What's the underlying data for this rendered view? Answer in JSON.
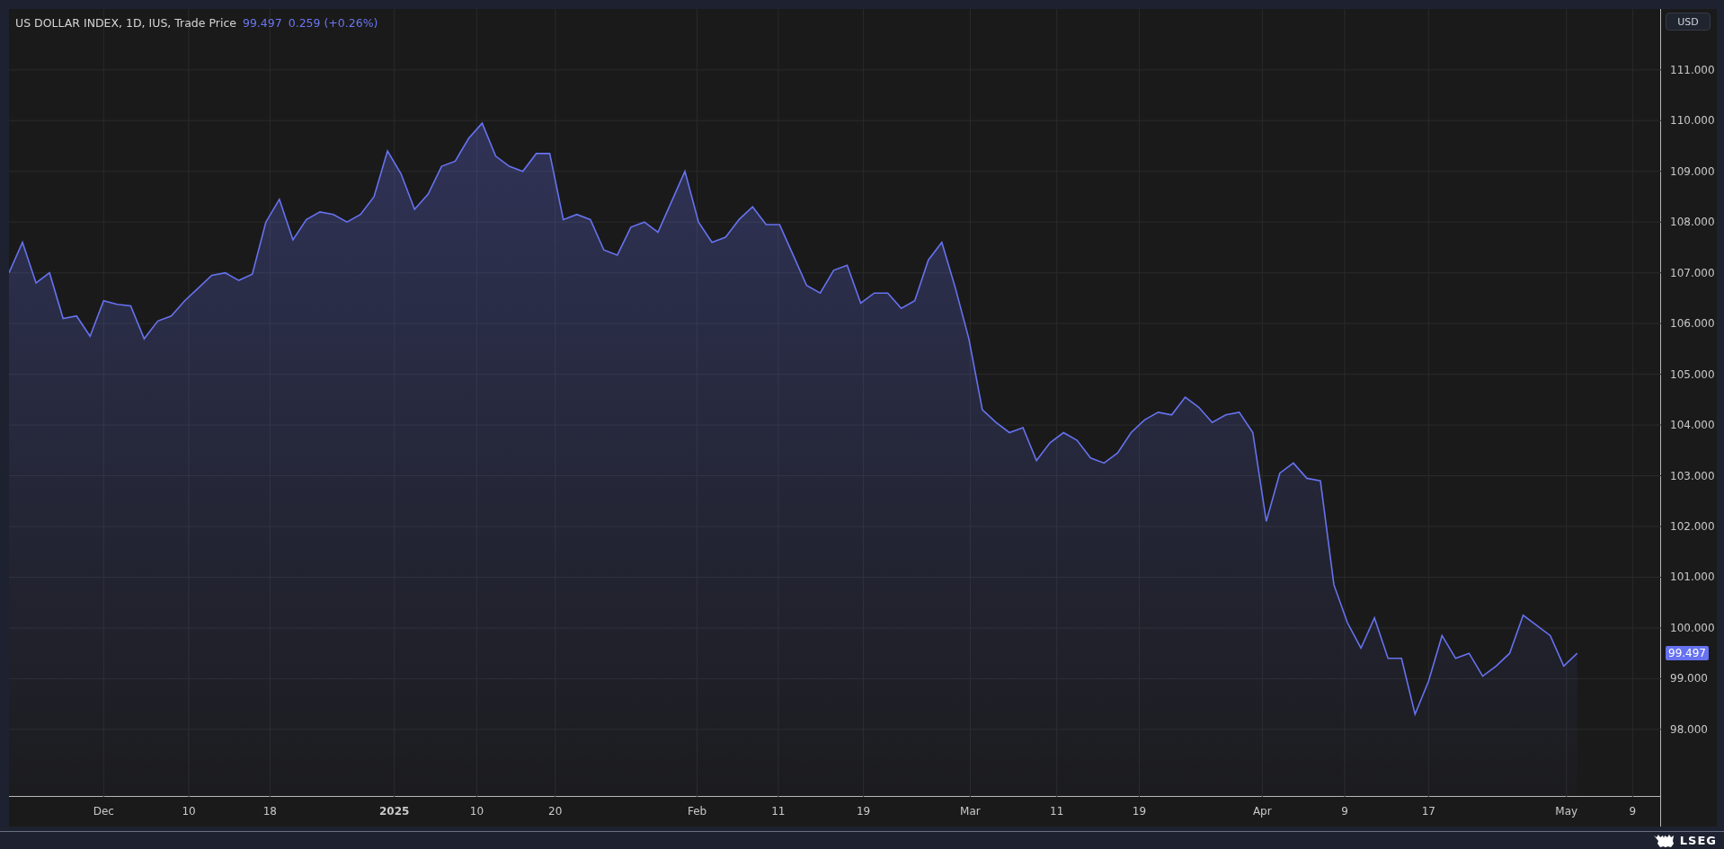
{
  "legend": {
    "title": "US DOLLAR INDEX, 1D, IUS, Trade Price",
    "last": "99.497",
    "change": "0.259 (+0.26%)"
  },
  "currency_button": "USD",
  "price_tag": "99.497",
  "logo": "LSEG",
  "x_axis_labels": [
    "Dec",
    "10",
    "18",
    "2025",
    "10",
    "20",
    "Feb",
    "11",
    "19",
    "Mar",
    "11",
    "19",
    "Apr",
    "9",
    "17",
    "May",
    "9"
  ],
  "chart_data": {
    "type": "area",
    "grid": true,
    "ylim": [
      96.67,
      112.2
    ],
    "series": [
      {
        "color": "#6672f0",
        "values": [
          107.0,
          107.6,
          106.8,
          107.0,
          106.1,
          106.15,
          105.75,
          106.45,
          106.38,
          106.35,
          105.7,
          106.05,
          106.15,
          106.45,
          106.7,
          106.95,
          107.0,
          106.85,
          106.97,
          108.0,
          108.45,
          107.65,
          108.05,
          108.2,
          108.15,
          108.0,
          108.15,
          108.5,
          109.4,
          108.95,
          108.25,
          108.55,
          109.1,
          109.2,
          109.65,
          109.95,
          109.3,
          109.1,
          109.0,
          109.35,
          109.35,
          108.05,
          108.15,
          108.05,
          107.45,
          107.35,
          107.9,
          108.0,
          107.8,
          108.4,
          109.0,
          108.0,
          107.6,
          107.7,
          108.05,
          108.3,
          107.95,
          107.95,
          107.35,
          106.75,
          106.6,
          107.05,
          107.15,
          106.4,
          106.6,
          106.6,
          106.3,
          106.45,
          107.25,
          107.6,
          106.7,
          105.7,
          104.3,
          104.05,
          103.85,
          103.95,
          103.3,
          103.65,
          103.85,
          103.7,
          103.35,
          103.25,
          103.45,
          103.85,
          104.1,
          104.25,
          104.2,
          104.55,
          104.35,
          104.05,
          104.2,
          104.25,
          103.85,
          102.1,
          103.05,
          103.25,
          102.95,
          102.9,
          100.85,
          100.1,
          99.6,
          100.2,
          99.4,
          99.4,
          98.3,
          98.95,
          99.85,
          99.4,
          99.5,
          99.05,
          99.25,
          99.5,
          100.25,
          100.05,
          99.85,
          99.25,
          99.5
        ]
      }
    ],
    "yticks": [
      {
        "value": 111,
        "label": "111.000"
      },
      {
        "value": 110,
        "label": "110.000"
      },
      {
        "value": 109,
        "label": "109.000"
      },
      {
        "value": 108,
        "label": "108.000"
      },
      {
        "value": 107,
        "label": "107.000"
      },
      {
        "value": 106,
        "label": "106.000"
      },
      {
        "value": 105,
        "label": "105.000"
      },
      {
        "value": 104,
        "label": "104.000"
      },
      {
        "value": 103,
        "label": "103.000"
      },
      {
        "value": 102,
        "label": "102.000"
      },
      {
        "value": 101,
        "label": "101.000"
      },
      {
        "value": 100,
        "label": "100.000"
      },
      {
        "value": 99,
        "label": "99.000"
      },
      {
        "value": 98,
        "label": "98.000"
      }
    ]
  }
}
